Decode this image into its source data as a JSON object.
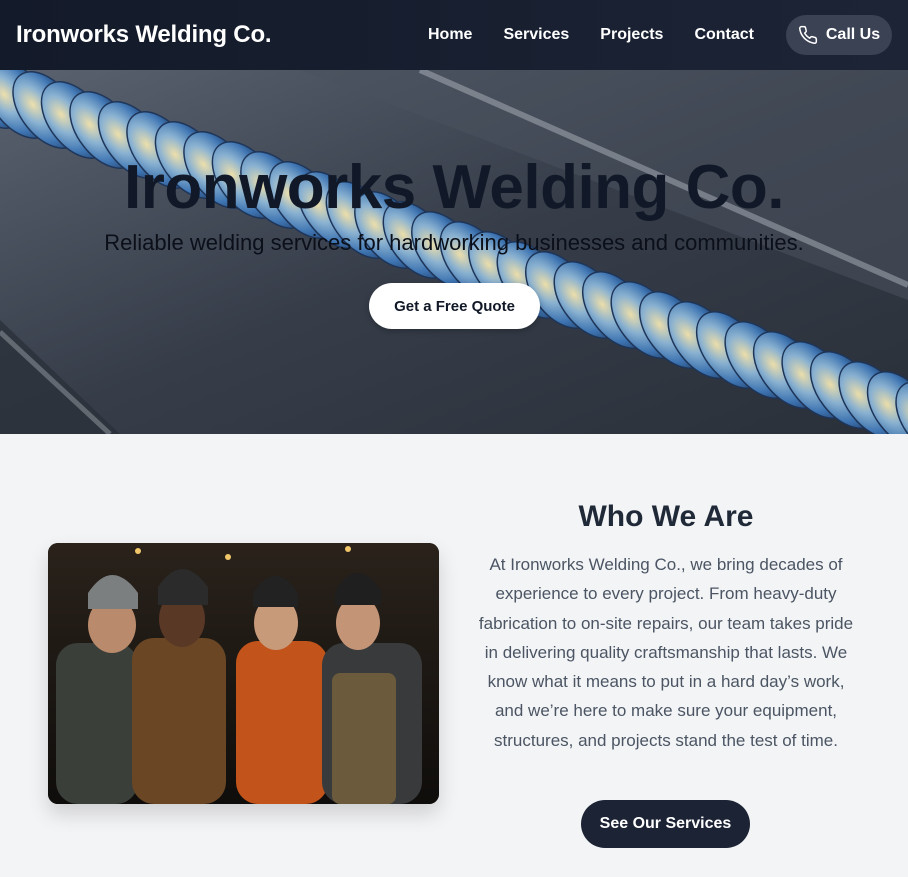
{
  "nav": {
    "brand": "Ironworks Welding Co.",
    "links": [
      "Home",
      "Services",
      "Projects",
      "Contact"
    ],
    "call_label": "Call Us",
    "call_icon": "phone-icon"
  },
  "hero": {
    "title": "Ironworks Welding Co.",
    "subtitle": "Reliable welding services for hardworking businesses and communities.",
    "cta_label": "Get a Free Quote"
  },
  "about": {
    "title": "Who We Are",
    "body": "At Ironworks Welding Co., we bring decades of experience to every project. From heavy-duty fabrication to on-site repairs, our team takes pride in delivering quality craftsmanship that lasts. We know what it means to put in a hard day’s work, and we’re here to make sure your equipment, structures, and projects stand the test of time.",
    "cta_label": "See Our Services"
  },
  "colors": {
    "nav_bg": "#161d2c",
    "accent_dark": "#1b2334",
    "page_bg": "#f3f4f6",
    "text_muted": "#4b5563"
  }
}
